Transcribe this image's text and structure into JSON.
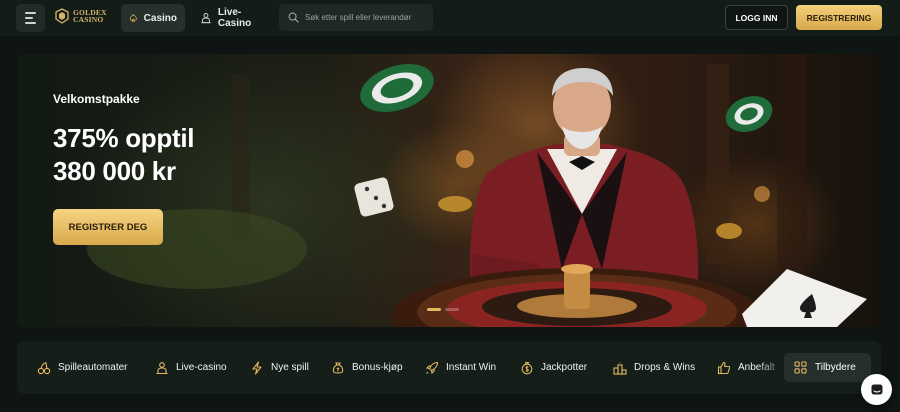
{
  "header": {
    "logo_text_line1": "GOLDEX",
    "logo_text_line2": "CASINO",
    "tabs": [
      {
        "label": "Casino",
        "icon": "spade-icon",
        "active": true
      },
      {
        "label": "Live-Casino",
        "icon": "dealer-icon",
        "active": false
      }
    ],
    "search_placeholder": "Søk etter spill eller leverandør",
    "login_label": "LOGG INN",
    "register_label": "REGISTRERING"
  },
  "hero": {
    "label": "Velkomstpakke",
    "title_line1": "375% opptil",
    "title_line2": "380 000 kr",
    "cta_label": "REGISTRER DEG",
    "slides_total": 2,
    "slide_active": 1
  },
  "categories": [
    {
      "label": "Spilleautomater",
      "icon": "slot-cherries-icon"
    },
    {
      "label": "Live-casino",
      "icon": "dealer-icon"
    },
    {
      "label": "Nye spill",
      "icon": "lightning-icon"
    },
    {
      "label": "Bonus-kjøp",
      "icon": "bonus-bag-icon"
    },
    {
      "label": "Instant Win",
      "icon": "rocket-icon"
    },
    {
      "label": "Jackpotter",
      "icon": "jackpot-coin-icon"
    },
    {
      "label": "Drops & Wins",
      "icon": "podium-icon"
    },
    {
      "label": "Anbefalt",
      "icon": "thumbs-up-icon"
    }
  ],
  "providers_label": "Tilbydere",
  "colors": {
    "gold": "#e4b860",
    "background": "#0e1512",
    "panel": "#161e1a"
  }
}
